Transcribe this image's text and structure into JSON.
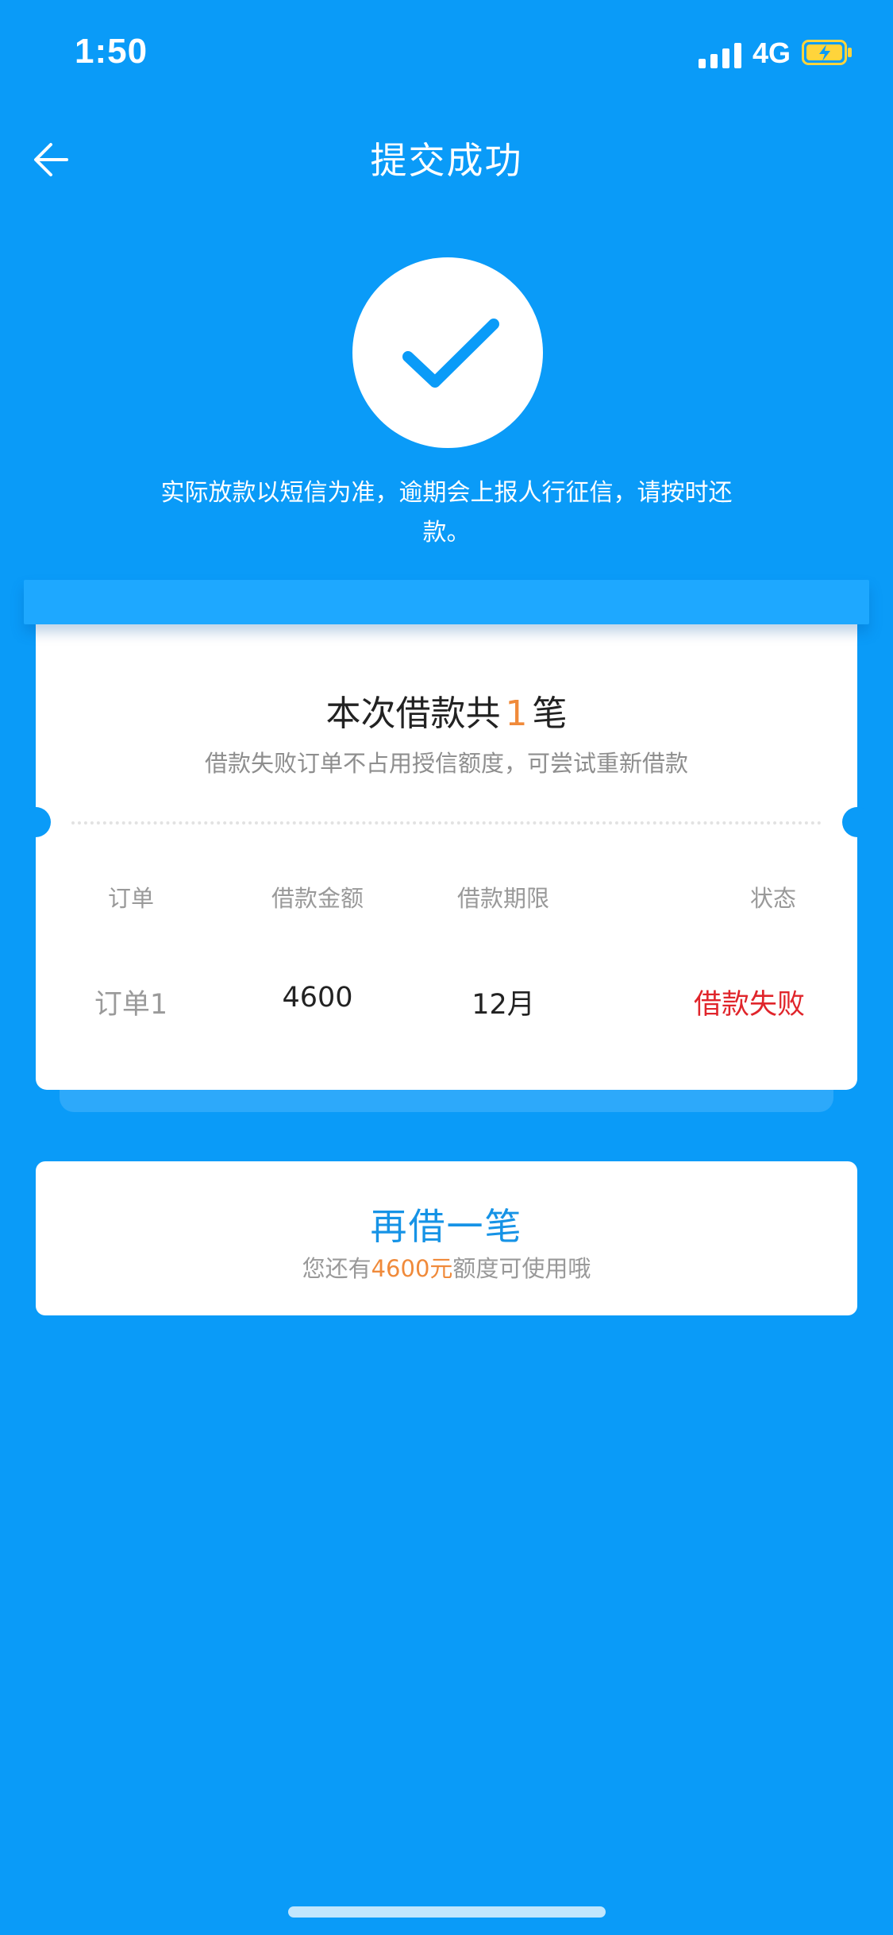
{
  "colors": {
    "background": "#0A9BF8",
    "accent_orange": "#F08A3A",
    "fail_red": "#E0252B",
    "link_blue": "#1693E6"
  },
  "status_bar": {
    "time": "1:50",
    "network": "4G",
    "icons": [
      "signal-icon",
      "battery-charging-icon"
    ]
  },
  "header": {
    "title": "提交成功",
    "back_icon": "arrow-left-icon"
  },
  "success": {
    "icon": "checkmark-icon",
    "notice_line1": "实际放款以短信为准，逾期会上报人行征信，请按时还",
    "notice_line2": "款。"
  },
  "summary": {
    "title_prefix": "本次借款共",
    "count": "1",
    "title_suffix": "笔",
    "subtitle": "借款失败订单不占用授信额度，可尝试重新借款"
  },
  "orders": {
    "columns": [
      "订单",
      "借款金额",
      "借款期限",
      "状态"
    ],
    "rows": [
      {
        "order": "订单1",
        "amount": "4600",
        "term": "12月",
        "status": "借款失败"
      }
    ]
  },
  "borrow_again": {
    "title": "再借一笔",
    "sub_prefix": "您还有",
    "sub_amount": "4600元",
    "sub_suffix": "额度可使用哦"
  }
}
